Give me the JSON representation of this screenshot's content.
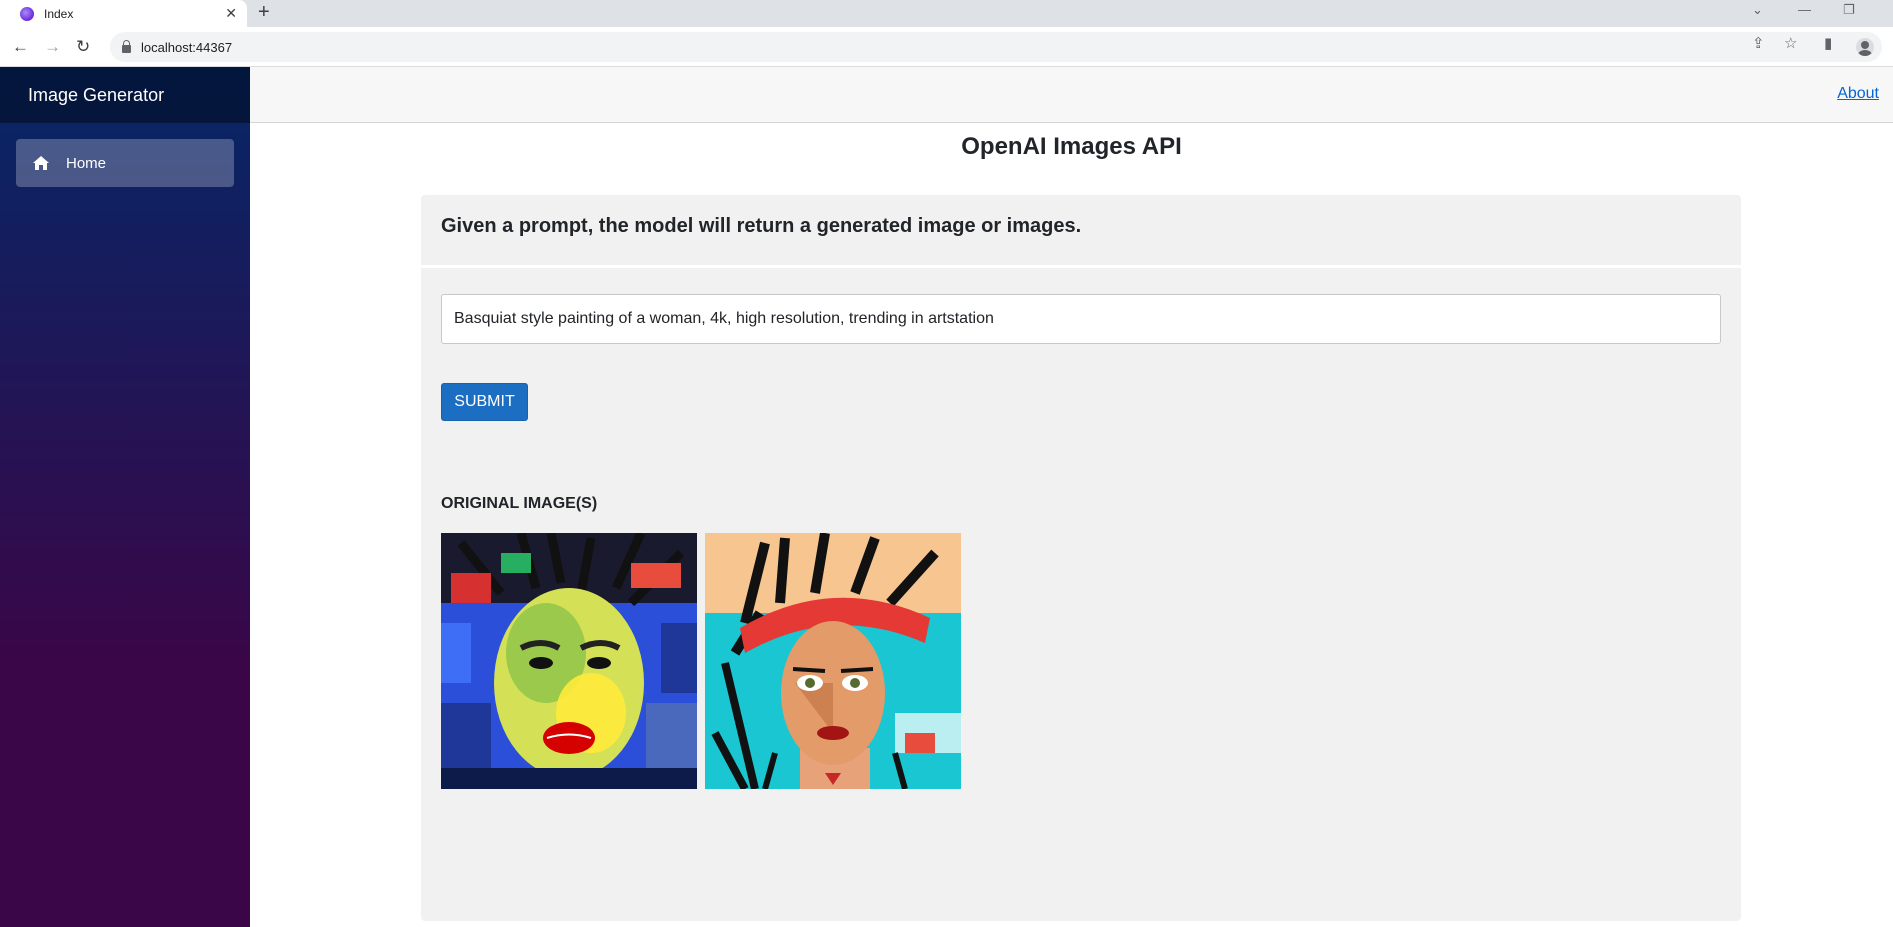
{
  "browser": {
    "tab_title": "Index",
    "url": "localhost:44367"
  },
  "sidebar": {
    "brand": "Image Generator",
    "items": [
      {
        "label": "Home",
        "icon": "home-icon",
        "active": true
      }
    ]
  },
  "topbar": {
    "about_label": "About"
  },
  "page": {
    "title": "OpenAI Images API",
    "description": "Given a prompt, the model will return a generated image or images.",
    "prompt_value": "Basquiat style painting of a woman, 4k, high resolution, trending in artstation",
    "submit_label": "SUBMIT",
    "results_label": "ORIGINAL IMAGE(S)"
  },
  "colors": {
    "accent": "#1b6ec2",
    "sidebar_top": "#052767",
    "sidebar_bottom": "#3a0647",
    "card_bg": "#f1f1f1",
    "link": "#0366d6"
  }
}
